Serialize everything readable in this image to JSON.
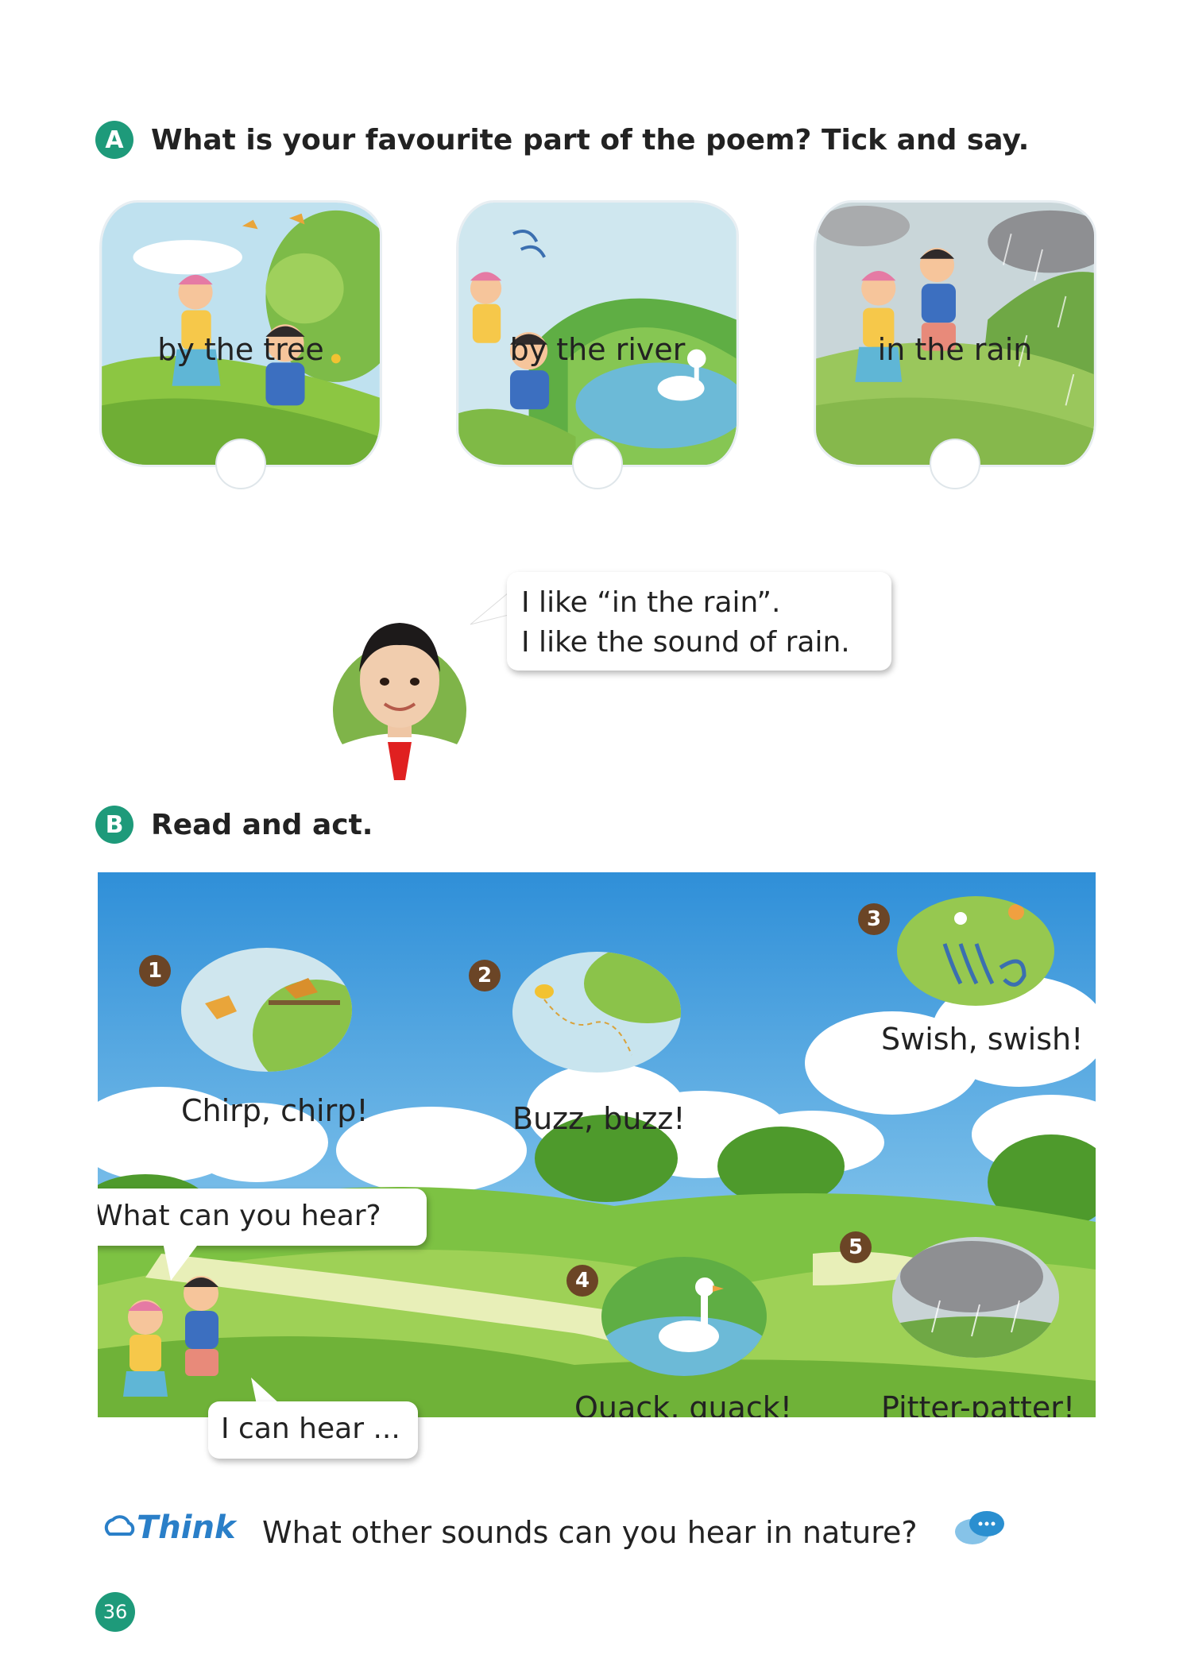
{
  "section_a": {
    "letter": "A",
    "title": "What is your favourite part of the poem? Tick and say.",
    "options": [
      {
        "caption": "by the tree"
      },
      {
        "caption": "by the river"
      },
      {
        "caption": "in the rain"
      }
    ],
    "speech": {
      "line1": "I like “in the rain”.",
      "line2": "I like the sound of rain."
    }
  },
  "section_b": {
    "letter": "B",
    "title": "Read and act.",
    "sounds": [
      {
        "number": "1",
        "label": "Chirp, chirp!"
      },
      {
        "number": "2",
        "label": "Buzz, buzz!"
      },
      {
        "number": "3",
        "label": "Swish, swish!"
      },
      {
        "number": "4",
        "label": "Quack, quack!"
      },
      {
        "number": "5",
        "label": "Pitter-patter!"
      }
    ],
    "question_bubble": "What can you hear?",
    "answer_bubble": "I can hear ..."
  },
  "think": {
    "logo": "Think",
    "question": "What other sounds can you hear in nature?"
  },
  "page_number": "36",
  "colors": {
    "badge": "#1e9a7a",
    "number_badge": "#6b4526",
    "think_logo": "#2a7fc8"
  }
}
